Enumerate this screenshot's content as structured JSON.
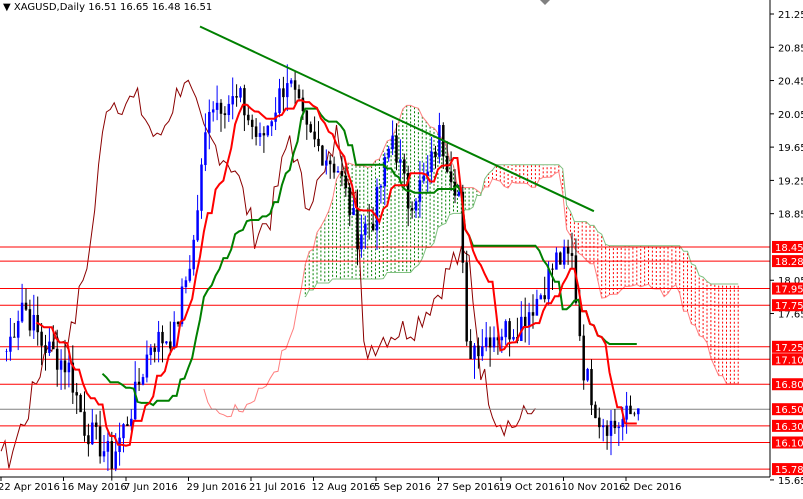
{
  "header": {
    "symbol_label": "XAGUSD,Daily",
    "ohlc": "16.51 16.65 16.48 16.51",
    "menu_icon": "triangle-down-icon"
  },
  "colors": {
    "bull": "#0000ff",
    "bear": "#000000",
    "tenkan": "#ff0000",
    "kijun": "#008000",
    "chikou": "#8b0000",
    "level": "#ff0000",
    "trend": "#008000",
    "current": "#808080"
  },
  "chart_data": {
    "type": "candlestick",
    "title": "XAGUSD,Daily",
    "ylim": [
      15.65,
      21.25
    ],
    "y_ticks": [
      "21.25",
      "20.85",
      "20.45",
      "20.05",
      "19.65",
      "19.25",
      "18.85",
      "18.05",
      "17.65",
      "15.65"
    ],
    "x_ticks": [
      "22 Apr 2016",
      "16 May 2016",
      "7 Jun 2016",
      "29 Jun 2016",
      "21 Jul 2016",
      "12 Aug 2016",
      "5 Sep 2016",
      "27 Sep 2016",
      "19 Oct 2016",
      "10 Nov 2016",
      "2 Dec 2016"
    ],
    "levels": [
      "18.45",
      "18.28",
      "17.95",
      "17.75",
      "17.25",
      "17.10",
      "16.80",
      "16.50",
      "16.30",
      "16.10",
      "15.78"
    ],
    "current_price": "16.50",
    "trendline": {
      "from": [
        50,
        21.1
      ],
      "to": [
        151,
        18.88
      ]
    },
    "close_keypoints": [
      [
        0,
        17.2
      ],
      [
        4,
        17.8
      ],
      [
        9,
        17.3
      ],
      [
        16,
        17.0
      ],
      [
        20,
        16.3
      ],
      [
        27,
        15.9
      ],
      [
        32,
        16.5
      ],
      [
        37,
        17.3
      ],
      [
        43,
        17.4
      ],
      [
        48,
        18.5
      ],
      [
        52,
        20.2
      ],
      [
        60,
        20.2
      ],
      [
        65,
        19.7
      ],
      [
        72,
        20.5
      ],
      [
        77,
        19.8
      ],
      [
        85,
        19.4
      ],
      [
        90,
        18.6
      ],
      [
        94,
        18.8
      ],
      [
        99,
        19.8
      ],
      [
        103,
        19.0
      ],
      [
        108,
        19.3
      ],
      [
        111,
        19.8
      ],
      [
        116,
        19.1
      ],
      [
        118,
        17.2
      ],
      [
        124,
        17.4
      ],
      [
        131,
        17.5
      ],
      [
        137,
        17.9
      ],
      [
        141,
        18.3
      ],
      [
        145,
        18.3
      ],
      [
        148,
        17.0
      ],
      [
        152,
        16.4
      ],
      [
        156,
        16.3
      ],
      [
        159,
        16.4
      ],
      [
        162,
        16.51
      ]
    ]
  }
}
